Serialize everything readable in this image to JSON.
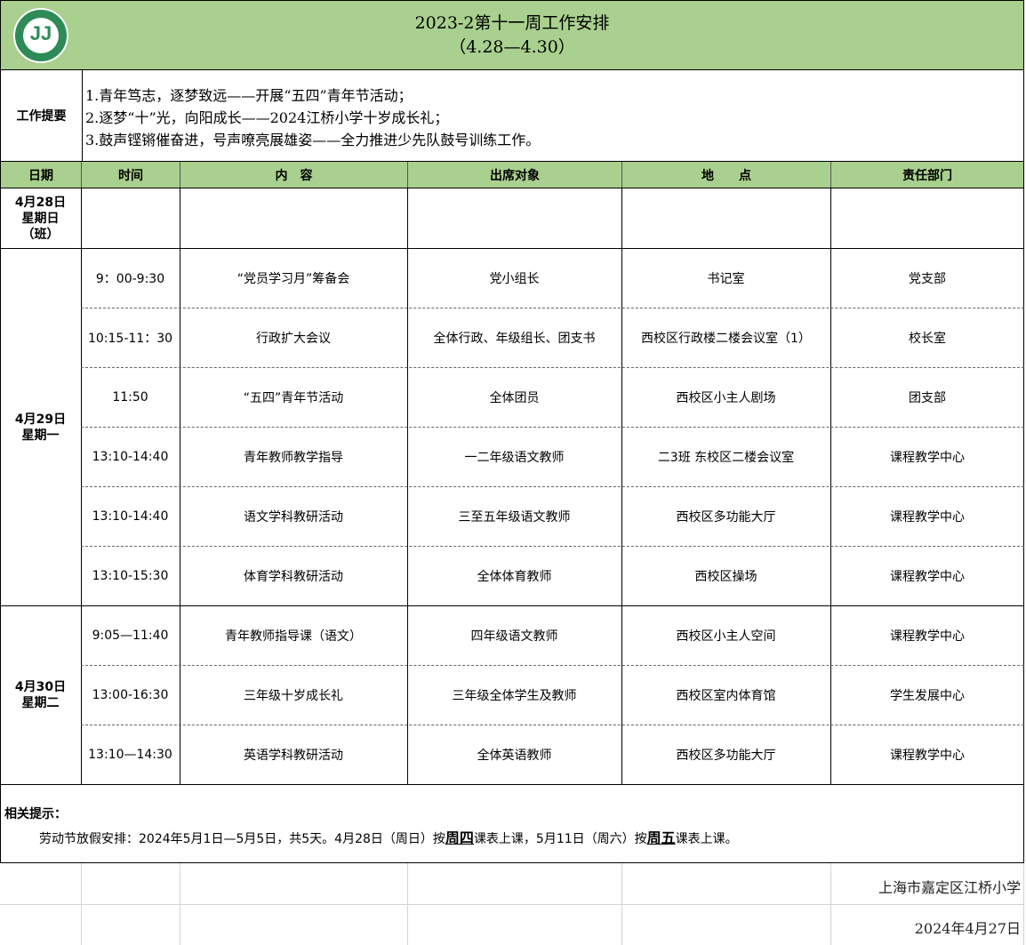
{
  "title": {
    "line1": "2023-2第十一周工作安排",
    "line2": "（4.28—4.30）"
  },
  "logo_icon": "school-logo-icon",
  "summary": {
    "label": "工作提要",
    "items": [
      "1.青年笃志，逐梦致远——开展“五四”青年节活动；",
      "2.逐梦“十”光，向阳成长——2024江桥小学十岁成长礼；",
      "3.鼓声铿锵催奋进，号声嘹亮展雄姿——全力推进少先队鼓号训练工作。"
    ]
  },
  "headers": [
    "日期",
    "时间",
    "内　容",
    "出席对象",
    "地　　点",
    "责任部门"
  ],
  "days": [
    {
      "date": "4月28日",
      "weekday": "星期日",
      "note": "（班）"
    },
    {
      "date": "4月29日",
      "weekday": "星期一"
    },
    {
      "date": "4月30日",
      "weekday": "星期二"
    }
  ],
  "rows": [
    {
      "time": "9：00-9:30",
      "content": "“党员学习月”筹备会",
      "attendees": "党小组长",
      "location": "书记室",
      "dept": "党支部"
    },
    {
      "time": "10:15-11：30",
      "content": "行政扩大会议",
      "attendees": "全体行政、年级组长、团支书",
      "location": "西校区行政楼二楼会议室（1）",
      "dept": "校长室"
    },
    {
      "time": "11:50",
      "content": "“五四”青年节活动",
      "attendees": "全体团员",
      "location": "西校区小主人剧场",
      "dept": "团支部"
    },
    {
      "time": "13:10-14:40",
      "content": "青年教师教学指导",
      "attendees": "一二年级语文教师",
      "location": "二3班 东校区二楼会议室",
      "dept": "课程教学中心"
    },
    {
      "time": "13:10-14:40",
      "content": "语文学科教研活动",
      "attendees": "三至五年级语文教师",
      "location": "西校区多功能大厅",
      "dept": "课程教学中心"
    },
    {
      "time": "13:10-15:30",
      "content": "体育学科教研活动",
      "attendees": "全体体育教师",
      "location": "西校区操场",
      "dept": "课程教学中心"
    },
    {
      "time": "9:05—11:40",
      "content": "青年教师指导课（语文）",
      "attendees": "四年级语文教师",
      "location": "西校区小主人空间",
      "dept": "课程教学中心"
    },
    {
      "time": "13:00-16:30",
      "content": "三年级十岁成长礼",
      "attendees": "三年级全体学生及教师",
      "location": "西校区室内体育馆",
      "dept": "学生发展中心"
    },
    {
      "time": "13:10—14:30",
      "content": "英语学科教研活动",
      "attendees": "全体英语教师",
      "location": "西校区多功能大厅",
      "dept": "课程教学中心"
    }
  ],
  "tips": {
    "title": "相关提示：",
    "part1": "劳动节放假安排：2024年5月1日—5月5日，共5天。4月28日（周日）按",
    "bold1": "周四",
    "part2": "课表上课，5月11日（周六）按",
    "bold2": "周五",
    "part3": "课表上课。"
  },
  "footer": {
    "school": "上海市嘉定区江桥小学",
    "date": "2024年4月27日"
  },
  "colors": {
    "header_bg": "#a9d08e",
    "logo": "#2e8b57"
  }
}
